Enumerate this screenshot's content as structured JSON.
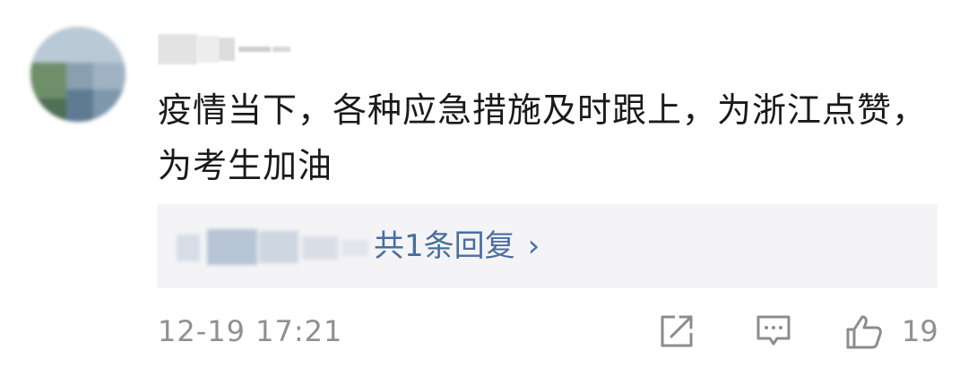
{
  "comment": {
    "username": "",
    "text": "疫情当下，各种应急措施及时跟上，为浙江点赞，为考生加油",
    "reply_summary": "共1条回复",
    "reply_chevron": "›",
    "timestamp": "12-19 17:21",
    "like_count": "19"
  },
  "icons": {
    "share": "share-icon",
    "reply": "comment-icon",
    "like": "thumbs-up-icon"
  },
  "colors": {
    "text": "#1a1a1a",
    "link": "#4a6e9e",
    "muted": "#909090",
    "reply_bg": "#f4f4f6"
  }
}
